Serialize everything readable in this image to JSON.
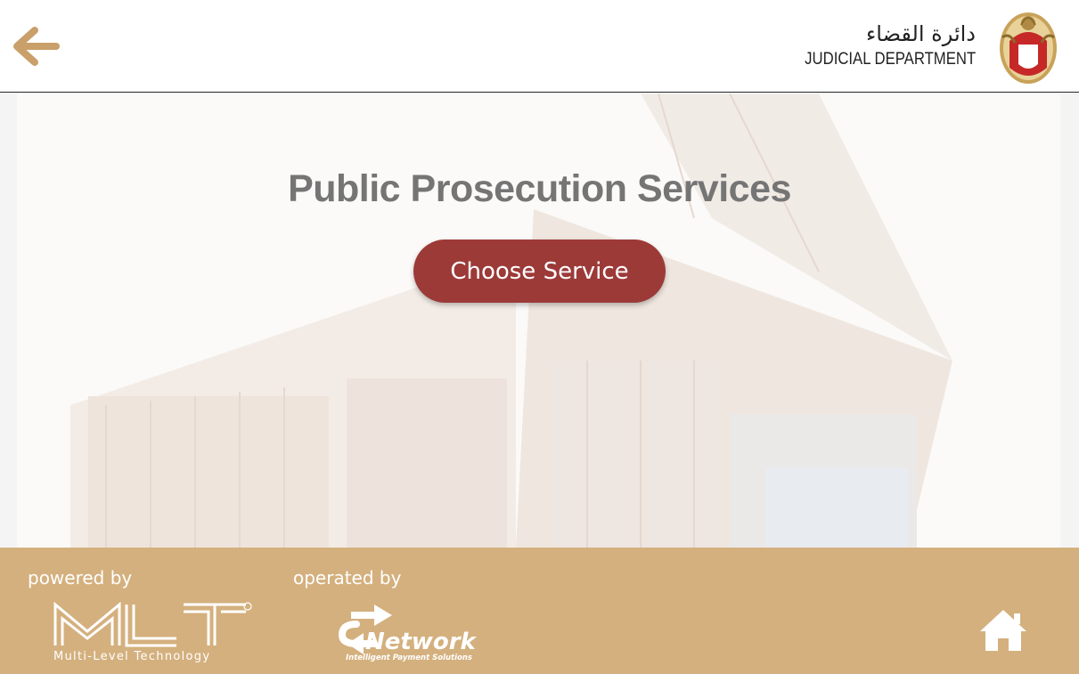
{
  "header": {
    "back_icon": "back-arrow-icon",
    "brand_arabic": "دائرة القضاء",
    "brand_english": "JUDICIAL DEPARTMENT",
    "emblem_icon": "falcon-emblem-icon"
  },
  "main": {
    "title": "Public Prosecution Services",
    "choose_button_label": "Choose Service"
  },
  "footer": {
    "powered_by_label": "powered by",
    "operated_by_label": "operated by",
    "mlt_logo_text": "MLT",
    "mlt_tagline": "Multi-Level Technology",
    "network_logo_text": "Network",
    "network_tagline": "Intelligent Payment Solutions",
    "home_icon": "home-icon"
  },
  "colors": {
    "accent": "#d4b07e",
    "button": "#9c3a38",
    "title": "#757575",
    "back_arrow": "#c9a06a"
  }
}
